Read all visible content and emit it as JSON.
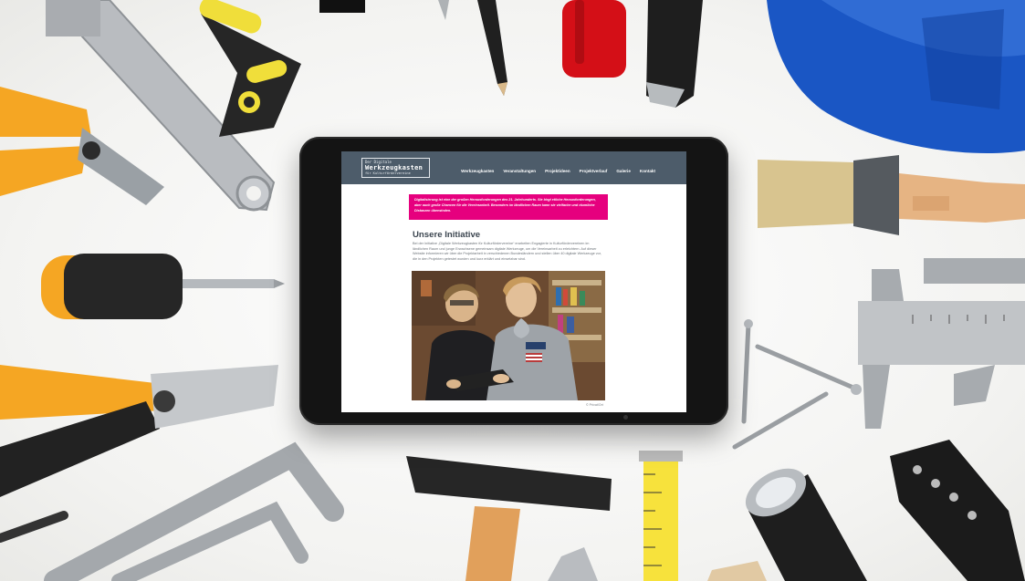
{
  "site": {
    "logo": {
      "line1": "Der Digitale",
      "line2": "Werkzeugkasten",
      "line3": "für Kulturfördervereine"
    },
    "nav": [
      "Werkzeugkasten",
      "Veranstaltungen",
      "Projektideen",
      "Projektverlauf",
      "Galerie",
      "Kontakt"
    ],
    "banner": "Digitalisierung ist eine der großen Herausforderungen des 21. Jahrhunderts. Sie birgt etliche Herausforderungen, aber auch große Chancen für die Vereinsarbeit. Besonders im ländlichen Raum kann sie vielfache und räumliche Distanzen überwinden.",
    "headline": "Unsere Initiative",
    "body": "Bei der Initiative „Digitale Werkzeugkasten für Kulturfördervereine“ erarbeiten Engagierte in Kulturfördervereinen im ländlichen Raum und junge Erwachsene gemeinsam digitale Werkzeuge, um die Vereinsarbeit zu erleichtern. Auf dieser Website informieren wir über die Projektarbeit in verschiedenen Bundesländern und stellen über 40 digitale Werkzeuge vor, die in den Projekten getestet wurden und kurz erklärt und einsetzbar sind.",
    "photo_caption": "© Privat/Ort"
  },
  "colors": {
    "header_bg": "#4d5c6a",
    "banner_bg": "#e6007e",
    "headline": "#3c4650"
  }
}
